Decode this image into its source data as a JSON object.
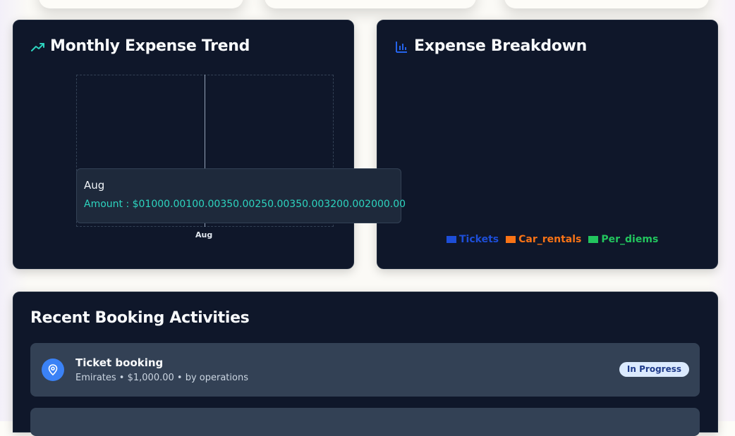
{
  "colors": {
    "card_bg": "#0f172a",
    "trend_icon": "#2dd4bf",
    "breakdown_icon": "#2563eb",
    "tooltip_value": "#2dd4bf",
    "status_badge_bg": "#dbeafe",
    "activity_icon_bg": "#3b82f6"
  },
  "trend": {
    "title": "Monthly Expense Trend",
    "icon": "trending-up-icon",
    "x_tick": "Aug",
    "tooltip": {
      "label": "Aug",
      "value": "Amount : $01000.00100.00350.00250.00350.003200.002000.00"
    }
  },
  "breakdown": {
    "title": "Expense Breakdown",
    "icon": "bar-chart-icon",
    "legend": [
      {
        "label": "Tickets",
        "color": "#1d4ed8"
      },
      {
        "label": "Car_rentals",
        "color": "#f97316"
      },
      {
        "label": "Per_diems",
        "color": "#22c55e"
      }
    ]
  },
  "activities": {
    "title": "Recent Booking Activities",
    "items": [
      {
        "icon": "map-pin-icon",
        "title": "Ticket booking",
        "meta": "Emirates • $1,000.00 • by operations",
        "status": "In Progress"
      },
      {
        "icon": "map-pin-icon",
        "title": "",
        "meta": "",
        "status": ""
      }
    ]
  }
}
